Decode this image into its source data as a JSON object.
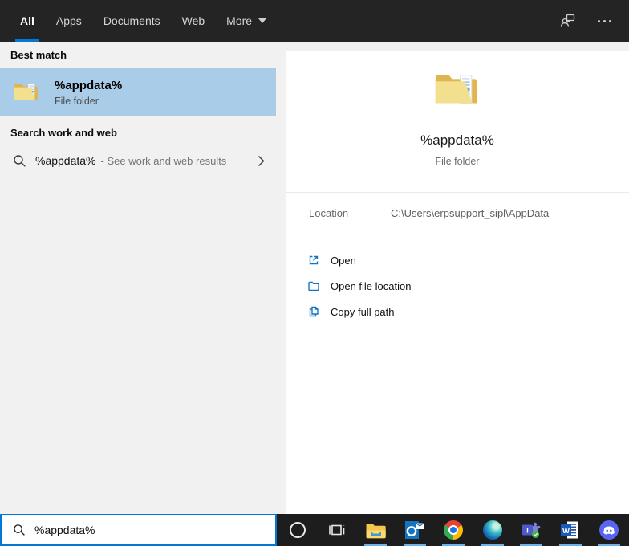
{
  "header": {
    "tabs": [
      {
        "label": "All",
        "active": true
      },
      {
        "label": "Apps",
        "active": false
      },
      {
        "label": "Documents",
        "active": false
      },
      {
        "label": "Web",
        "active": false
      },
      {
        "label": "More",
        "active": false,
        "has_dropdown": true
      }
    ],
    "icons": [
      "feedback-icon",
      "ellipsis-icon"
    ]
  },
  "left_panel": {
    "best_match": {
      "section_label": "Best match",
      "item": {
        "title": "%appdata%",
        "subtitle": "File folder",
        "icon": "folder-icon"
      }
    },
    "search_web": {
      "section_label": "Search work and web",
      "item": {
        "query": "%appdata%",
        "suffix": "- See work and web results",
        "icon": "search-icon"
      }
    }
  },
  "preview_panel": {
    "icon": "folder-icon",
    "title": "%appdata%",
    "subtitle": "File folder",
    "location_label": "Location",
    "location_link": "C:\\Users\\erpsupport_sipl\\AppData",
    "actions": [
      {
        "label": "Open",
        "icon": "open-icon"
      },
      {
        "label": "Open file location",
        "icon": "open-file-location-icon"
      },
      {
        "label": "Copy full path",
        "icon": "copy-path-icon"
      }
    ]
  },
  "search_box": {
    "value": "%appdata%",
    "icon": "search-icon"
  },
  "taskbar": {
    "items": [
      {
        "name": "cortana",
        "running": false
      },
      {
        "name": "task-view",
        "running": false
      },
      {
        "name": "file-explorer",
        "running": true
      },
      {
        "name": "outlook",
        "running": true
      },
      {
        "name": "chrome",
        "running": true
      },
      {
        "name": "edge",
        "running": true
      },
      {
        "name": "teams",
        "running": true
      },
      {
        "name": "word",
        "running": true
      },
      {
        "name": "discord",
        "running": true
      }
    ]
  },
  "colors": {
    "accent": "#0078d7",
    "header_bg": "#242424",
    "taskbar_bg": "#1d1d1d",
    "highlight": "#a9cce9",
    "panel_gray": "#f1f1f1",
    "action_icon_blue": "#1474c4",
    "running_indicator": "#6cb2e8"
  }
}
